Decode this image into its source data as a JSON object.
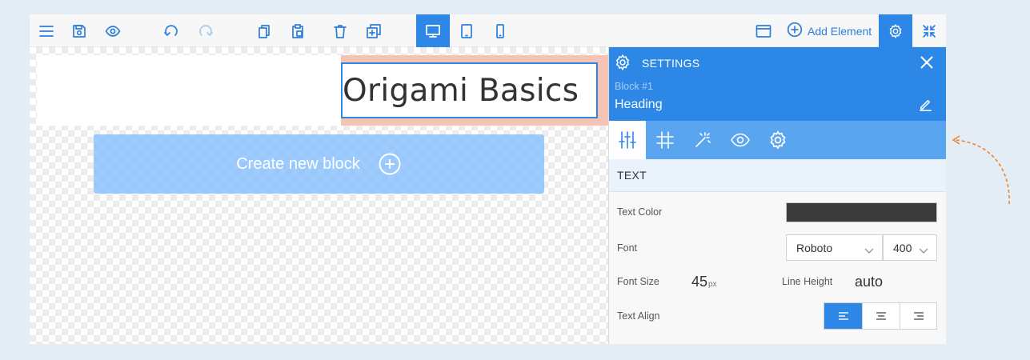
{
  "toolbar": {
    "items": [
      {
        "name": "menu-icon"
      },
      {
        "name": "save-icon"
      },
      {
        "name": "preview-eye-icon"
      },
      {
        "name": "undo-icon"
      },
      {
        "name": "redo-icon"
      },
      {
        "name": "copy-icon"
      },
      {
        "name": "paste-icon"
      },
      {
        "name": "delete-icon"
      },
      {
        "name": "duplicate-icon"
      }
    ],
    "devices": [
      {
        "name": "desktop-icon",
        "active": true
      },
      {
        "name": "tablet-icon",
        "active": false
      },
      {
        "name": "mobile-icon",
        "active": false
      }
    ],
    "add_element_label": "Add Element"
  },
  "canvas": {
    "heading_text": "Origami Basics",
    "create_block_label": "Create new block"
  },
  "settings": {
    "title": "SETTINGS",
    "block_number": "Block #1",
    "element_name": "Heading",
    "tabs": [
      "sliders-icon",
      "layout-grid-icon",
      "magic-wand-icon",
      "eye-icon",
      "gear-icon"
    ],
    "section_title": "TEXT",
    "fields": {
      "text_color_label": "Text Color",
      "text_color_value": "#3a3a3a",
      "font_label": "Font",
      "font_family_value": "Roboto",
      "font_weight_value": "400",
      "font_size_label": "Font Size",
      "font_size_value": "45",
      "font_size_unit": "px",
      "line_height_label": "Line Height",
      "line_height_value": "auto",
      "text_align_label": "Text Align",
      "text_align_options": [
        "left",
        "center",
        "right"
      ],
      "text_align_selected": "left"
    }
  },
  "colors": {
    "accent": "#2d87e6",
    "tab_bar": "#5aa5f0",
    "heading_padding": "#f6c4b5",
    "annotation_arrow": "#e8892f"
  }
}
